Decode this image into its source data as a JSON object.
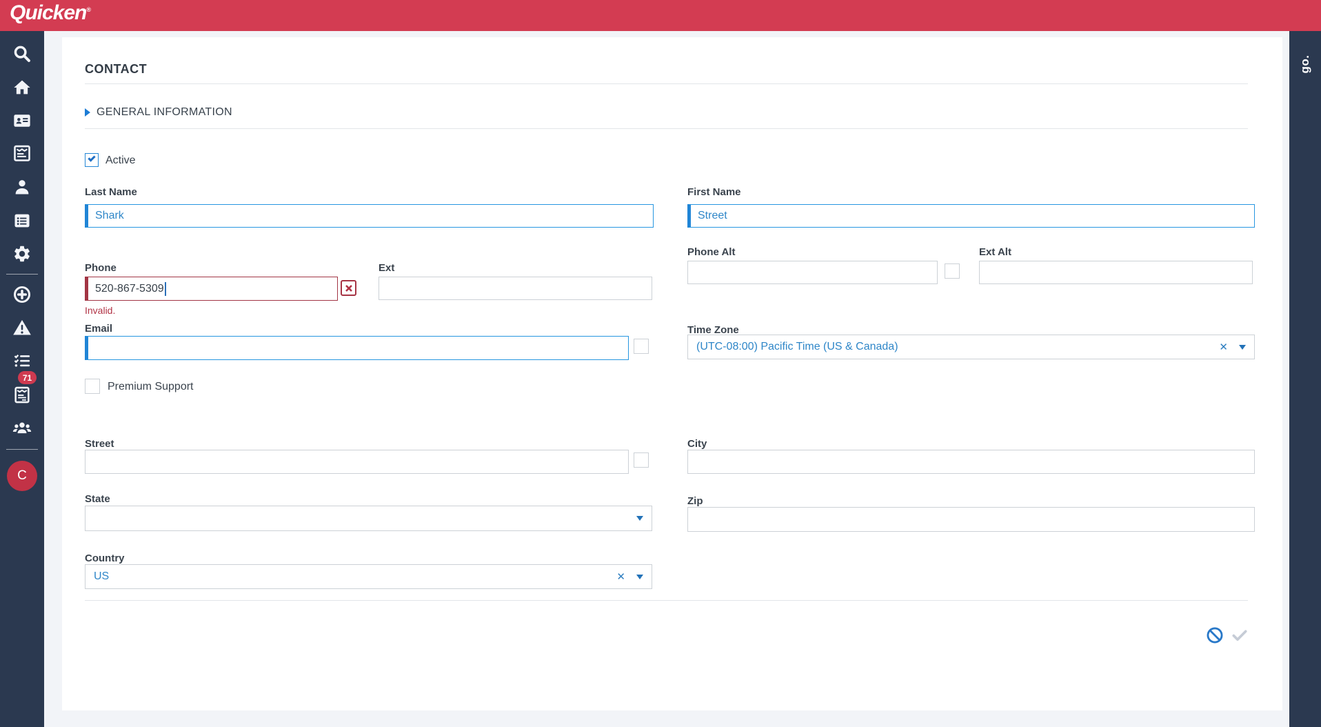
{
  "colors": {
    "header_red": "#d33c52",
    "sidebar_navy": "#2b3950",
    "accent_blue": "#2085d6",
    "value_blue": "#2e86c8",
    "error_maroon": "#a63444",
    "badge_red": "#cf3a50",
    "page_bg": "#f2f4f8"
  },
  "header": {
    "logo": "Quicken",
    "logo_mark": "®"
  },
  "sidebar": {
    "icons": [
      "search-icon",
      "home-icon",
      "address-card-icon",
      "news-icon",
      "user-icon",
      "list-icon",
      "gear-icon",
      "plus-circle-icon",
      "warning-icon",
      "checklist-icon",
      "forms-icon",
      "people-icon"
    ],
    "badge_count": "71",
    "avatar_initial": "C"
  },
  "right_rail": {
    "brand": "go."
  },
  "contact": {
    "title": "CONTACT",
    "section_title": "GENERAL INFORMATION",
    "active": {
      "label": "Active",
      "checked": true
    },
    "fields": {
      "last_name": {
        "label": "Last Name",
        "value": "Shark"
      },
      "first_name": {
        "label": "First Name",
        "value": "Street"
      },
      "phone": {
        "label": "Phone",
        "value": "520-867-5309",
        "error": "Invalid."
      },
      "ext": {
        "label": "Ext",
        "value": ""
      },
      "phone_alt": {
        "label": "Phone Alt",
        "value": ""
      },
      "ext_alt": {
        "label": "Ext Alt",
        "value": ""
      },
      "email": {
        "label": "Email",
        "value": ""
      },
      "time_zone": {
        "label": "Time Zone",
        "value": "(UTC-08:00) Pacific Time (US & Canada)"
      },
      "premium_support": {
        "label": "Premium Support",
        "checked": false
      },
      "street": {
        "label": "Street",
        "value": ""
      },
      "city": {
        "label": "City",
        "value": ""
      },
      "state": {
        "label": "State",
        "value": ""
      },
      "zip": {
        "label": "Zip",
        "value": ""
      },
      "country": {
        "label": "Country",
        "value": "US"
      }
    }
  }
}
